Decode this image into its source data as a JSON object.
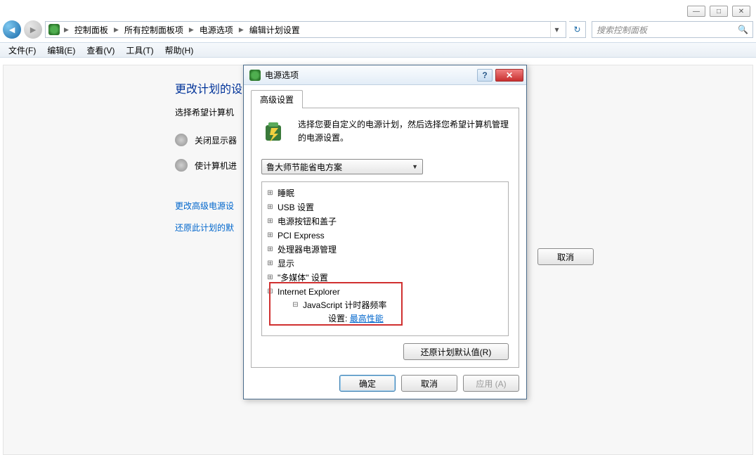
{
  "window_controls": {
    "min": "—",
    "max": "□",
    "close": "✕"
  },
  "breadcrumb": {
    "items": [
      "控制面板",
      "所有控制面板项",
      "电源选项",
      "编辑计划设置"
    ]
  },
  "search": {
    "placeholder": "搜索控制面板"
  },
  "menubar": [
    "文件(F)",
    "编辑(E)",
    "查看(V)",
    "工具(T)",
    "帮助(H)"
  ],
  "page": {
    "title": "更改计划的设",
    "subtitle": "选择希望计算机",
    "opt1": "关闭显示器",
    "opt2": "使计算机进",
    "link1": "更改高级电源设",
    "link2": "还原此计划的默",
    "cancel": "取消"
  },
  "dialog": {
    "title": "电源选项",
    "tab": "高级设置",
    "description": "选择您要自定义的电源计划，然后选择您希望计算机管理的电源设置。",
    "plan": "鲁大师节能省电方案",
    "tree": {
      "n0": "睡眠",
      "n1": "USB 设置",
      "n2": "电源按钮和盖子",
      "n3": "PCI Express",
      "n4": "处理器电源管理",
      "n5": "显示",
      "n6": "\"多媒体\" 设置",
      "n7": "Internet Explorer",
      "n7_0": "JavaScript 计时器频率",
      "n7_0_label": "设置:",
      "n7_0_value": "最高性能"
    },
    "restore": "还原计划默认值(R)",
    "ok": "确定",
    "cancel": "取消",
    "apply": "应用 (A)"
  }
}
